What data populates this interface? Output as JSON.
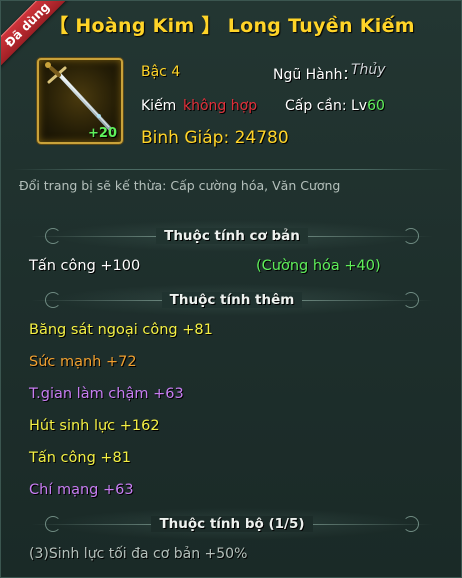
{
  "badge": "Đã dùng",
  "title": "【 Hoàng Kim 】 Long Tuyền Kiếm",
  "item": {
    "enhance": "+20",
    "tier_label": "Bậc 4",
    "element_label": "Ngũ Hành：",
    "element_value": "Thủy",
    "type_label": "Kiếm",
    "type_status": "không hợp",
    "level_label": "Cấp cần: Lv",
    "level_value": "60",
    "score_label": "Binh Giáp: 24780"
  },
  "inherit_note": "Đổi trang bị sẽ kế thừa: Cấp cường hóa, Văn Cương",
  "base": {
    "header": "Thuộc tính cơ bản",
    "stat": "Tấn công +100",
    "bonus": "(Cường hóa +40)"
  },
  "extra": {
    "header": "Thuộc tính thêm",
    "attrs": [
      {
        "text": "Băng sát ngoại công  +81",
        "color": "#f4f044"
      },
      {
        "text": "Sức mạnh +72",
        "color": "#f0a030"
      },
      {
        "text": "T.gian làm chậm +63",
        "color": "#c77df2"
      },
      {
        "text": "Hút sinh lực  +162",
        "color": "#f4f044"
      },
      {
        "text": "Tấn công +81",
        "color": "#f4f044"
      },
      {
        "text": "Chí mạng +63",
        "color": "#c77df2"
      }
    ]
  },
  "set": {
    "header": "Thuộc tính bộ (1/5)",
    "bonus": "(3)Sinh lực tối đa cơ bản +50%"
  },
  "colors": {
    "title": "#ffd428",
    "gold": "#ffd428",
    "green": "#5ff05a",
    "red": "#e0303a",
    "white": "#ffffff",
    "gray": "#b4c0bb",
    "water": "#cfd4d8"
  }
}
